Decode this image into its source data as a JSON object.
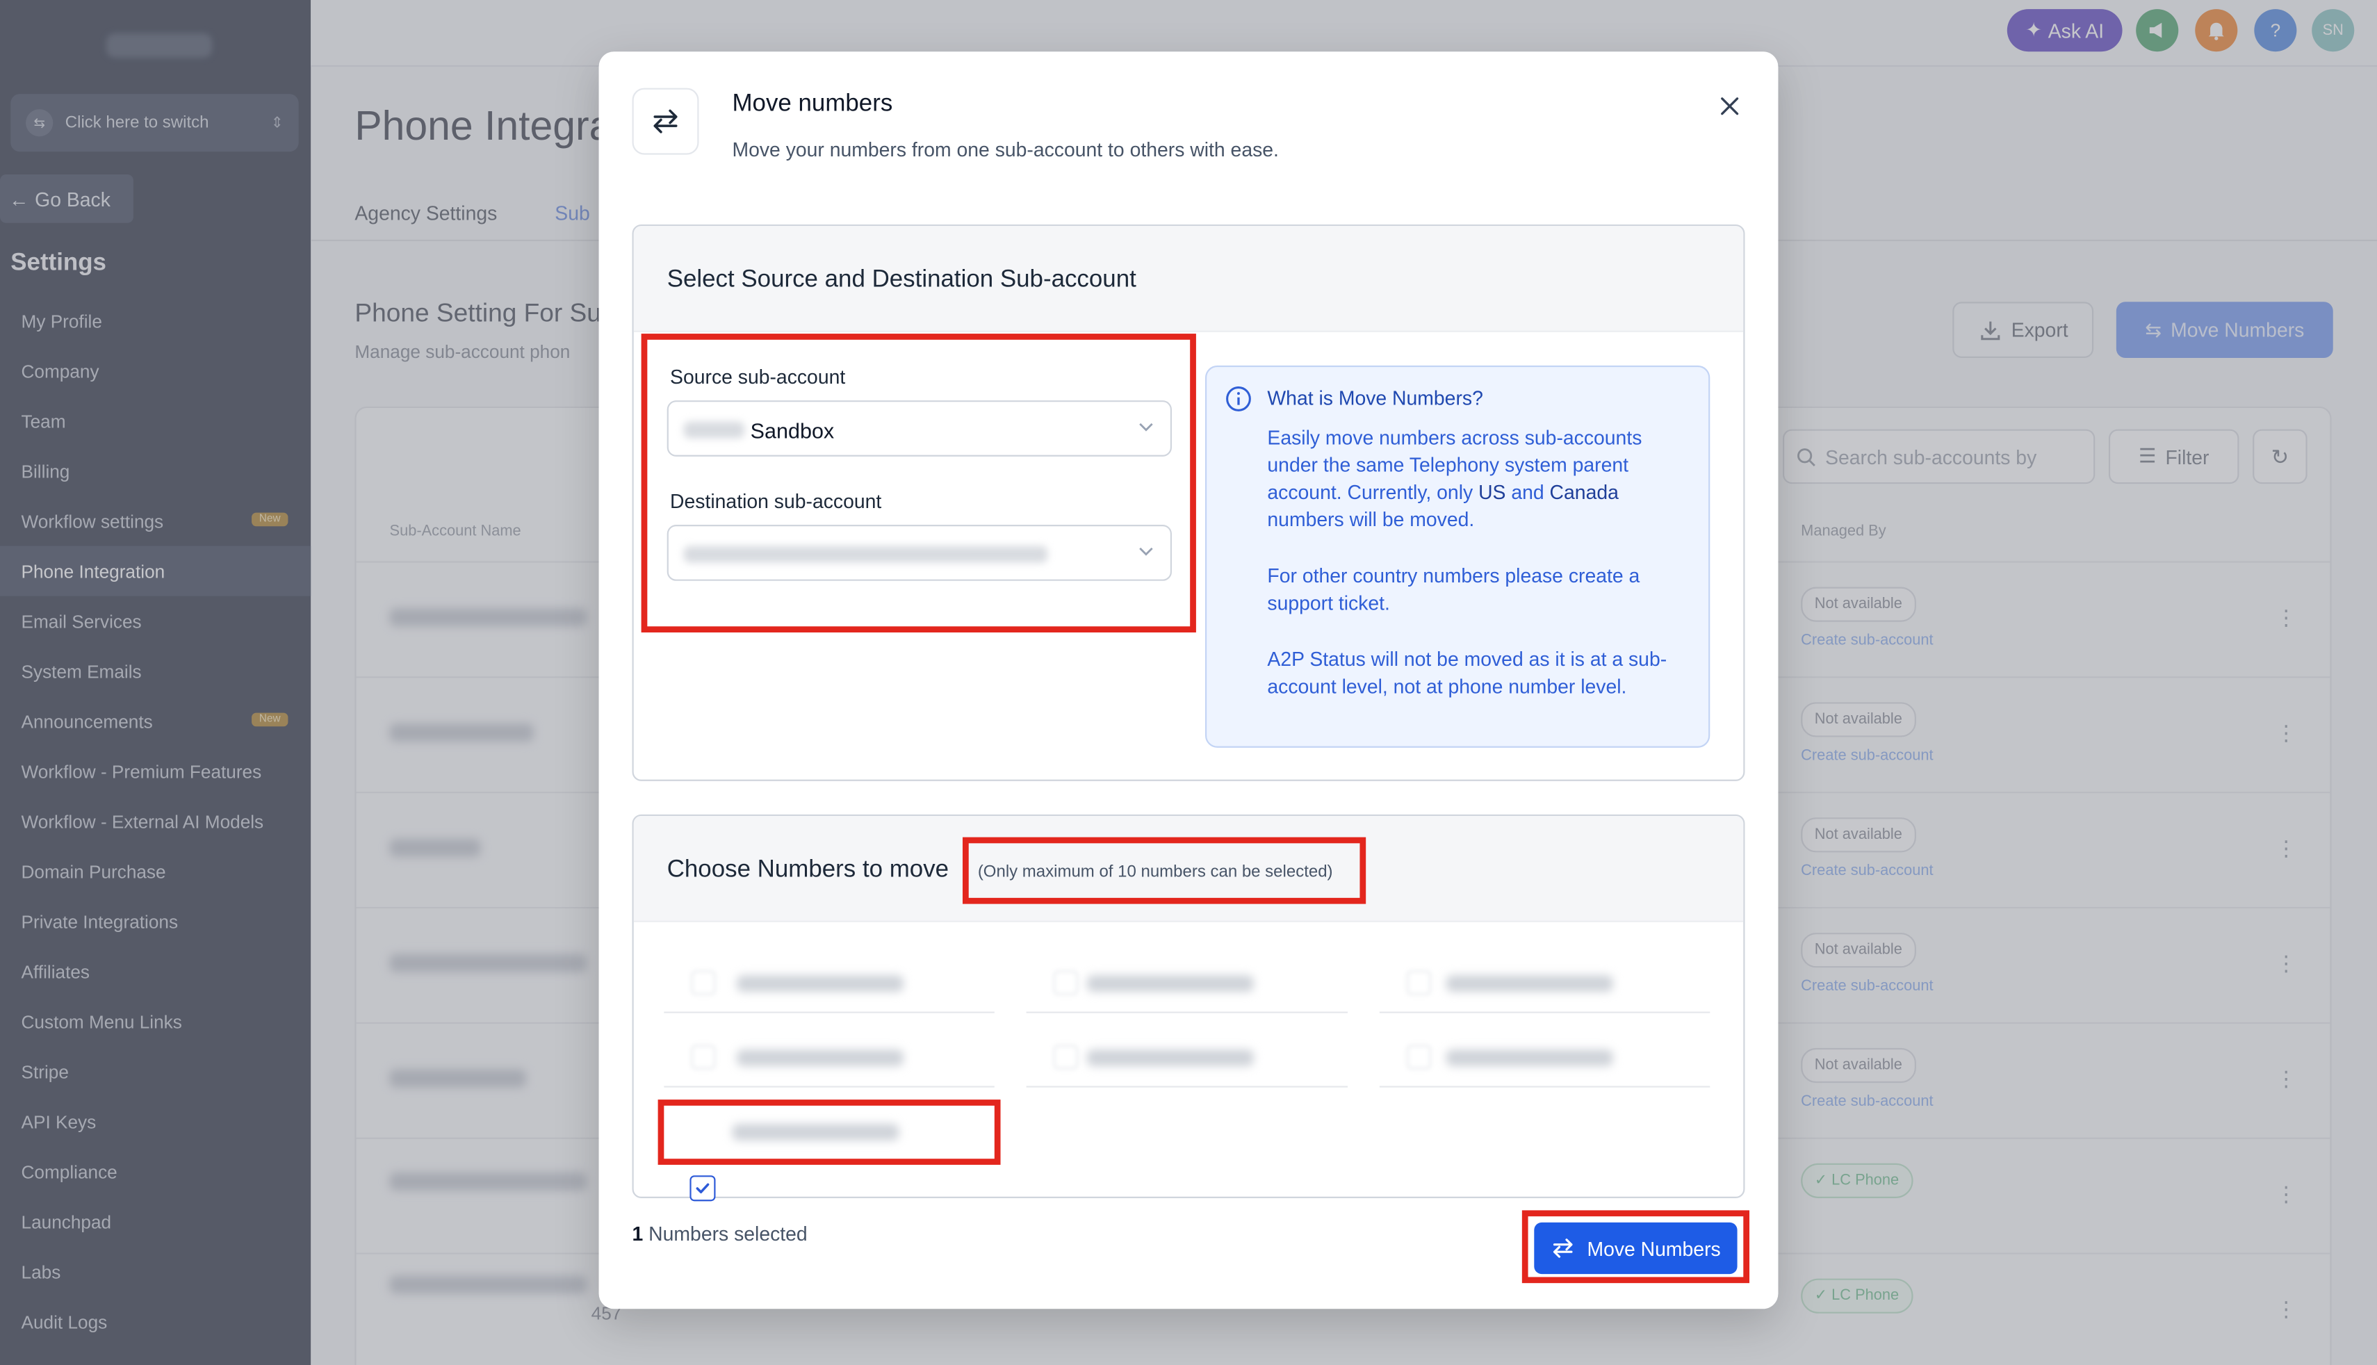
{
  "sidebar": {
    "switcher_label": "Click here to switch",
    "go_back": "Go Back",
    "settings_heading": "Settings",
    "new_badge": "New",
    "items": [
      {
        "label": "My Profile"
      },
      {
        "label": "Company"
      },
      {
        "label": "Team"
      },
      {
        "label": "Billing"
      },
      {
        "label": "Workflow settings",
        "badge": "New"
      },
      {
        "label": "Phone Integration",
        "active": true
      },
      {
        "label": "Email Services"
      },
      {
        "label": "System Emails"
      },
      {
        "label": "Announcements",
        "badge": "New"
      },
      {
        "label": "Workflow - Premium Features"
      },
      {
        "label": "Workflow - External AI Models"
      },
      {
        "label": "Domain Purchase"
      },
      {
        "label": "Private Integrations"
      },
      {
        "label": "Affiliates"
      },
      {
        "label": "Custom Menu Links"
      },
      {
        "label": "Stripe"
      },
      {
        "label": "API Keys"
      },
      {
        "label": "Compliance"
      },
      {
        "label": "Launchpad"
      },
      {
        "label": "Labs"
      },
      {
        "label": "Audit Logs"
      }
    ]
  },
  "topbar": {
    "ask_ai": "Ask AI",
    "avatar_initials": "SN",
    "help_symbol": "?"
  },
  "page": {
    "title": "Phone Integra",
    "tab_agency": "Agency Settings",
    "tab_sub": "Sub",
    "section_title": "Phone Setting For Su",
    "section_subtitle": "Manage sub-account phon",
    "export_label": "Export",
    "move_numbers_label": "Move Numbers",
    "search_placeholder": "Search sub-accounts by",
    "filter_label": "Filter",
    "col_subaccount": "Sub-Account Name",
    "col_managed_by": "Managed By",
    "rows": [
      {
        "status": "Not available",
        "link": "Create sub-account"
      },
      {
        "status": "Not available",
        "link": "Create sub-account"
      },
      {
        "status": "Not available",
        "link": "Create sub-account"
      },
      {
        "status": "Not available",
        "link": "Create sub-account"
      },
      {
        "status": "Not available",
        "link": "Create sub-account"
      },
      {
        "status": "LC Phone",
        "link": ""
      },
      {
        "status": "LC Phone",
        "link": ""
      }
    ],
    "row_partial_number": "457"
  },
  "modal": {
    "title": "Move numbers",
    "description": "Move your numbers from one sub-account to others with ease.",
    "select_section_title": "Select Source and Destination Sub-account",
    "source_label": "Source sub-account",
    "source_value": "Sandbox",
    "destination_label": "Destination sub-account",
    "info": {
      "title": "What is Move Numbers?",
      "p1_a": "Easily move numbers across sub-accounts under the same Telephony system parent account. Currently, only ",
      "p1_us": "US",
      "p1_and": " and ",
      "p1_ca": "Canada",
      "p1_b": " numbers will be moved.",
      "p2": "For other country numbers please create a support ticket.",
      "p3": "A2P Status will not be moved as it is at a sub-account level, not at phone number level."
    },
    "choose_title": "Choose Numbers to move",
    "choose_note": "(Only maximum of 10 numbers can be selected)",
    "selected_count": "1",
    "selected_suffix": " Numbers selected",
    "move_button": "Move Numbers"
  },
  "colors": {
    "primary": "#1e5ce6",
    "highlight_red": "#e3261d",
    "info_bg": "#eef4ff",
    "sidebar_bg": "#3e4454"
  }
}
